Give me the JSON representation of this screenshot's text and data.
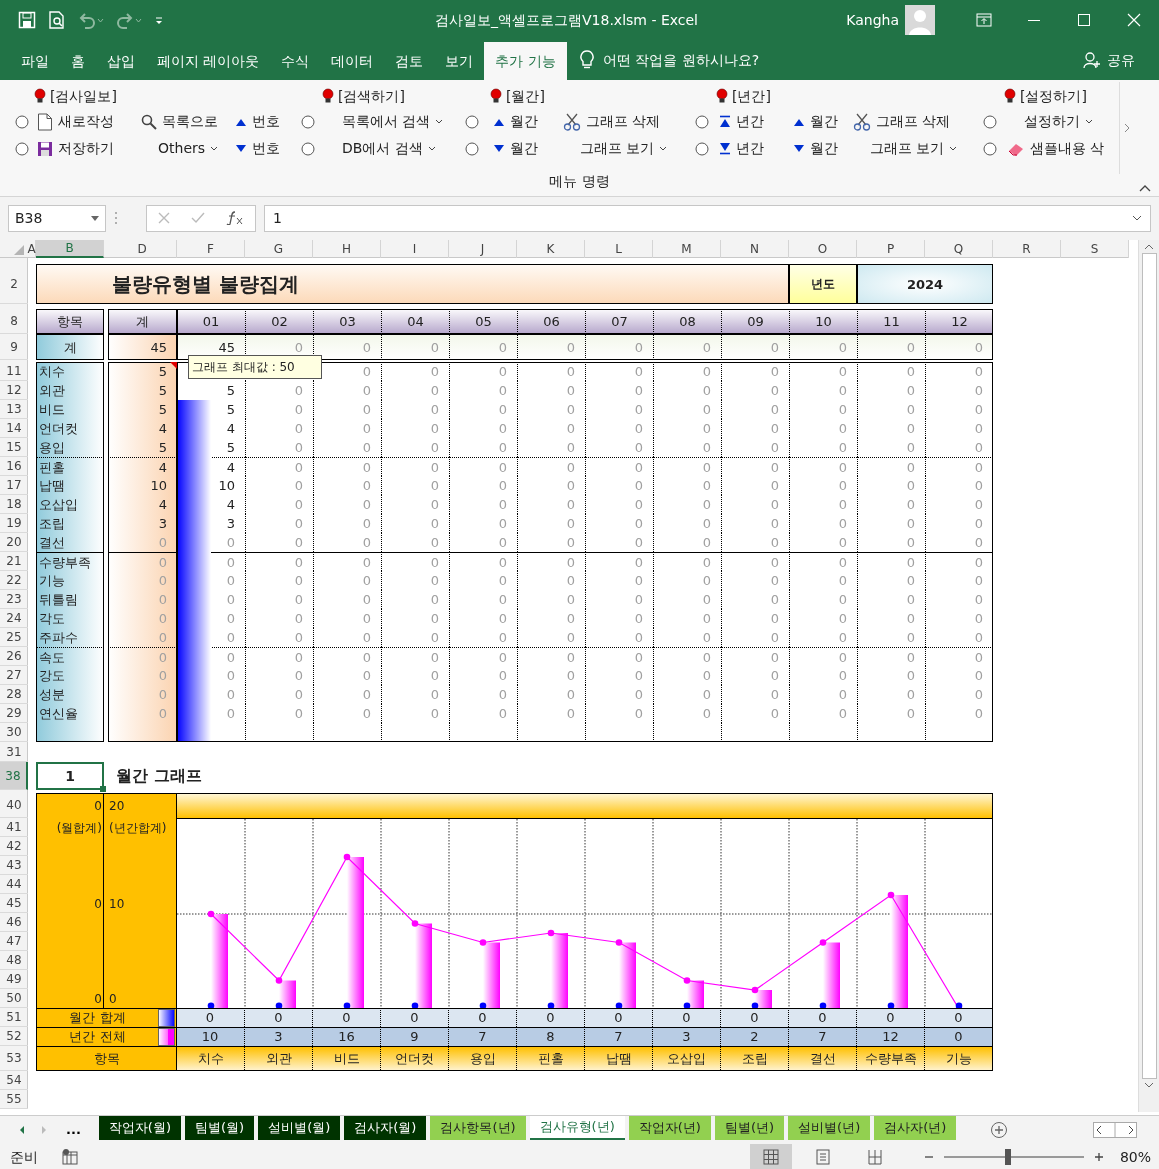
{
  "window": {
    "title": "검사일보_액셀프로그램V18.xlsm  -  Excel",
    "user": "Kangha"
  },
  "quick_access": [
    {
      "kind": "save",
      "disabled": false
    },
    {
      "kind": "print_preview",
      "disabled": false
    },
    {
      "kind": "undo",
      "disabled": true
    },
    {
      "kind": "redo",
      "disabled": true
    },
    {
      "kind": "customize",
      "disabled": false
    }
  ],
  "ribbon_tabs": [
    {
      "label": "파일",
      "selected": false
    },
    {
      "label": "홈",
      "selected": false
    },
    {
      "label": "삽입",
      "selected": false
    },
    {
      "label": "페이지 레이아웃",
      "selected": false
    },
    {
      "label": "수식",
      "selected": false
    },
    {
      "label": "데이터",
      "selected": false
    },
    {
      "label": "검토",
      "selected": false
    },
    {
      "label": "보기",
      "selected": false
    },
    {
      "label": "추가 기능",
      "selected": true
    }
  ],
  "tell_me": "어떤 작업을 원하시나요?",
  "share": "공유",
  "ribbon": {
    "group_label": "메뉴 명령",
    "columns": [
      {
        "items": [
          {
            "kind": "radio",
            "checked": false
          },
          {
            "kind": "radio",
            "checked": false
          }
        ]
      },
      {
        "header": "[검사일보]",
        "items": [
          {
            "kind": "new",
            "label": "새로작성"
          },
          {
            "kind": "save",
            "label": "저장하기"
          }
        ]
      },
      {
        "items": [
          {
            "kind": "search",
            "label": "목록으로"
          },
          {
            "kind": "dropdown",
            "label": "Others"
          }
        ]
      },
      {
        "items": [
          {
            "kind": "up",
            "label": "번호"
          },
          {
            "kind": "down",
            "label": "번호"
          }
        ]
      },
      {
        "items": [
          {
            "kind": "radio",
            "checked": false
          },
          {
            "kind": "radio",
            "checked": false
          }
        ]
      },
      {
        "header": "[검색하기]",
        "items": [
          {
            "kind": "dropdown",
            "label": "목록에서 검색"
          },
          {
            "kind": "dropdown",
            "label": "DB에서 검색"
          }
        ]
      },
      {
        "items": [
          {
            "kind": "radio",
            "checked": false
          },
          {
            "kind": "radio",
            "checked": false
          }
        ]
      },
      {
        "header": "[월간]",
        "items": [
          {
            "kind": "up",
            "label": "월간"
          },
          {
            "kind": "down",
            "label": "월간"
          }
        ]
      },
      {
        "items": [
          {
            "kind": "cut",
            "label": "그래프 삭제"
          },
          {
            "kind": "dropdown",
            "label": "그래프 보기"
          }
        ]
      },
      {
        "items": [
          {
            "kind": "radio",
            "checked": false
          },
          {
            "kind": "radio",
            "checked": false
          }
        ]
      },
      {
        "header": "[년간]",
        "items": [
          {
            "kind": "top",
            "label": "년간"
          },
          {
            "kind": "bottom",
            "label": "년간"
          }
        ]
      },
      {
        "items": [
          {
            "kind": "up",
            "label": "월간"
          },
          {
            "kind": "down",
            "label": "월간"
          }
        ]
      },
      {
        "items": [
          {
            "kind": "cut",
            "label": "그래프 삭제"
          },
          {
            "kind": "dropdown",
            "label": "그래프 보기"
          }
        ]
      },
      {
        "items": [
          {
            "kind": "radio",
            "checked": false
          },
          {
            "kind": "radio",
            "checked": false
          }
        ]
      },
      {
        "header": "[설정하기]",
        "items": [
          {
            "kind": "dropdown",
            "label": "설정하기"
          },
          {
            "kind": "eraser",
            "label": "샘플내용 삭"
          }
        ]
      }
    ]
  },
  "formula_bar": {
    "name_box": "B38",
    "formula": "1"
  },
  "column_headers": [
    {
      "label": "A",
      "selected": false
    },
    {
      "label": "B",
      "selected": true
    },
    {
      "label": "D",
      "selected": false
    },
    {
      "label": "F",
      "selected": false
    },
    {
      "label": "G",
      "selected": false
    },
    {
      "label": "H",
      "selected": false
    },
    {
      "label": "I",
      "selected": false
    },
    {
      "label": "J",
      "selected": false
    },
    {
      "label": "K",
      "selected": false
    },
    {
      "label": "L",
      "selected": false
    },
    {
      "label": "M",
      "selected": false
    },
    {
      "label": "N",
      "selected": false
    },
    {
      "label": "O",
      "selected": false
    },
    {
      "label": "P",
      "selected": false
    },
    {
      "label": "Q",
      "selected": false
    },
    {
      "label": "R",
      "selected": false
    },
    {
      "label": "S",
      "selected": false
    }
  ],
  "row_headers": [
    {
      "label": "2",
      "selected": false
    },
    {
      "label": "8",
      "selected": false
    },
    {
      "label": "9",
      "selected": false
    },
    {
      "label": "11",
      "selected": false
    },
    {
      "label": "12",
      "selected": false
    },
    {
      "label": "13",
      "selected": false
    },
    {
      "label": "14",
      "selected": false
    },
    {
      "label": "15",
      "selected": false
    },
    {
      "label": "16",
      "selected": false
    },
    {
      "label": "17",
      "selected": false
    },
    {
      "label": "18",
      "selected": false
    },
    {
      "label": "19",
      "selected": false
    },
    {
      "label": "20",
      "selected": false
    },
    {
      "label": "21",
      "selected": false
    },
    {
      "label": "22",
      "selected": false
    },
    {
      "label": "23",
      "selected": false
    },
    {
      "label": "24",
      "selected": false
    },
    {
      "label": "25",
      "selected": false
    },
    {
      "label": "26",
      "selected": false
    },
    {
      "label": "27",
      "selected": false
    },
    {
      "label": "28",
      "selected": false
    },
    {
      "label": "29",
      "selected": false
    },
    {
      "label": "30",
      "selected": false
    },
    {
      "label": "31",
      "selected": false
    },
    {
      "label": "38",
      "selected": true
    },
    {
      "label": "40",
      "selected": false
    },
    {
      "label": "41",
      "selected": false
    },
    {
      "label": "42",
      "selected": false
    },
    {
      "label": "43",
      "selected": false
    },
    {
      "label": "44",
      "selected": false
    },
    {
      "label": "45",
      "selected": false
    },
    {
      "label": "46",
      "selected": false
    },
    {
      "label": "47",
      "selected": false
    },
    {
      "label": "48",
      "selected": false
    },
    {
      "label": "49",
      "selected": false
    },
    {
      "label": "50",
      "selected": false
    },
    {
      "label": "51",
      "selected": false
    },
    {
      "label": "52",
      "selected": false
    },
    {
      "label": "53",
      "selected": false
    },
    {
      "label": "54",
      "selected": false
    },
    {
      "label": "55",
      "selected": false
    }
  ],
  "report": {
    "title": "불량유형별 불량집계",
    "year_label": "년도",
    "year": "2024",
    "comment": "그래프 최대값 : 50",
    "header": {
      "item": "항목",
      "total": "계",
      "months": [
        "01",
        "02",
        "03",
        "04",
        "05",
        "06",
        "07",
        "08",
        "09",
        "10",
        "11",
        "12"
      ]
    },
    "total_row": {
      "label": "계",
      "total": "45",
      "months": [
        {
          "text": "45",
          "muted": false
        },
        {
          "text": "0",
          "muted": true
        },
        {
          "text": "0",
          "muted": true
        },
        {
          "text": "0",
          "muted": true
        },
        {
          "text": "0",
          "muted": true
        },
        {
          "text": "0",
          "muted": true
        },
        {
          "text": "0",
          "muted": true
        },
        {
          "text": "0",
          "muted": true
        },
        {
          "text": "0",
          "muted": true
        },
        {
          "text": "0",
          "muted": true
        },
        {
          "text": "0",
          "muted": true
        },
        {
          "text": "0",
          "muted": true
        }
      ]
    },
    "groups": [
      [
        {
          "label": "치수",
          "covered_by_note": true,
          "total": {
            "text": "5",
            "muted": false
          },
          "months": [
            {
              "text": "0",
              "muted": true
            },
            {
              "text": "0",
              "muted": true
            },
            {
              "text": "0",
              "muted": true
            },
            {
              "text": "0",
              "muted": true
            },
            {
              "text": "0",
              "muted": true
            },
            {
              "text": "0",
              "muted": true
            },
            {
              "text": "0",
              "muted": true
            },
            {
              "text": "0",
              "muted": true
            },
            {
              "text": "0",
              "muted": true
            },
            {
              "text": "0",
              "muted": true
            }
          ]
        },
        {
          "label": "외관",
          "total": {
            "text": "5",
            "muted": false
          },
          "months": [
            {
              "text": "5",
              "muted": false
            },
            {
              "text": "0",
              "muted": true
            },
            {
              "text": "0",
              "muted": true
            },
            {
              "text": "0",
              "muted": true
            },
            {
              "text": "0",
              "muted": true
            },
            {
              "text": "0",
              "muted": true
            },
            {
              "text": "0",
              "muted": true
            },
            {
              "text": "0",
              "muted": true
            },
            {
              "text": "0",
              "muted": true
            },
            {
              "text": "0",
              "muted": true
            },
            {
              "text": "0",
              "muted": true
            },
            {
              "text": "0",
              "muted": true
            }
          ]
        },
        {
          "label": "비드",
          "total": {
            "text": "5",
            "muted": false
          },
          "months": [
            {
              "text": "5",
              "muted": false
            },
            {
              "text": "0",
              "muted": true
            },
            {
              "text": "0",
              "muted": true
            },
            {
              "text": "0",
              "muted": true
            },
            {
              "text": "0",
              "muted": true
            },
            {
              "text": "0",
              "muted": true
            },
            {
              "text": "0",
              "muted": true
            },
            {
              "text": "0",
              "muted": true
            },
            {
              "text": "0",
              "muted": true
            },
            {
              "text": "0",
              "muted": true
            },
            {
              "text": "0",
              "muted": true
            },
            {
              "text": "0",
              "muted": true
            }
          ]
        },
        {
          "label": "언더컷",
          "total": {
            "text": "4",
            "muted": false
          },
          "months": [
            {
              "text": "4",
              "muted": false
            },
            {
              "text": "0",
              "muted": true
            },
            {
              "text": "0",
              "muted": true
            },
            {
              "text": "0",
              "muted": true
            },
            {
              "text": "0",
              "muted": true
            },
            {
              "text": "0",
              "muted": true
            },
            {
              "text": "0",
              "muted": true
            },
            {
              "text": "0",
              "muted": true
            },
            {
              "text": "0",
              "muted": true
            },
            {
              "text": "0",
              "muted": true
            },
            {
              "text": "0",
              "muted": true
            },
            {
              "text": "0",
              "muted": true
            }
          ]
        },
        {
          "label": "용입",
          "total": {
            "text": "5",
            "muted": false
          },
          "months": [
            {
              "text": "5",
              "muted": false
            },
            {
              "text": "0",
              "muted": true
            },
            {
              "text": "0",
              "muted": true
            },
            {
              "text": "0",
              "muted": true
            },
            {
              "text": "0",
              "muted": true
            },
            {
              "text": "0",
              "muted": true
            },
            {
              "text": "0",
              "muted": true
            },
            {
              "text": "0",
              "muted": true
            },
            {
              "text": "0",
              "muted": true
            },
            {
              "text": "0",
              "muted": true
            },
            {
              "text": "0",
              "muted": true
            },
            {
              "text": "0",
              "muted": true
            }
          ]
        }
      ],
      [
        {
          "label": "핀홀",
          "total": {
            "text": "4",
            "muted": false
          },
          "months": [
            {
              "text": "4",
              "muted": false
            },
            {
              "text": "0",
              "muted": true
            },
            {
              "text": "0",
              "muted": true
            },
            {
              "text": "0",
              "muted": true
            },
            {
              "text": "0",
              "muted": true
            },
            {
              "text": "0",
              "muted": true
            },
            {
              "text": "0",
              "muted": true
            },
            {
              "text": "0",
              "muted": true
            },
            {
              "text": "0",
              "muted": true
            },
            {
              "text": "0",
              "muted": true
            },
            {
              "text": "0",
              "muted": true
            },
            {
              "text": "0",
              "muted": true
            }
          ]
        },
        {
          "label": "납땜",
          "total": {
            "text": "10",
            "muted": false
          },
          "months": [
            {
              "text": "10",
              "muted": false
            },
            {
              "text": "0",
              "muted": true
            },
            {
              "text": "0",
              "muted": true
            },
            {
              "text": "0",
              "muted": true
            },
            {
              "text": "0",
              "muted": true
            },
            {
              "text": "0",
              "muted": true
            },
            {
              "text": "0",
              "muted": true
            },
            {
              "text": "0",
              "muted": true
            },
            {
              "text": "0",
              "muted": true
            },
            {
              "text": "0",
              "muted": true
            },
            {
              "text": "0",
              "muted": true
            },
            {
              "text": "0",
              "muted": true
            }
          ]
        },
        {
          "label": "오삽입",
          "total": {
            "text": "4",
            "muted": false
          },
          "months": [
            {
              "text": "4",
              "muted": false
            },
            {
              "text": "0",
              "muted": true
            },
            {
              "text": "0",
              "muted": true
            },
            {
              "text": "0",
              "muted": true
            },
            {
              "text": "0",
              "muted": true
            },
            {
              "text": "0",
              "muted": true
            },
            {
              "text": "0",
              "muted": true
            },
            {
              "text": "0",
              "muted": true
            },
            {
              "text": "0",
              "muted": true
            },
            {
              "text": "0",
              "muted": true
            },
            {
              "text": "0",
              "muted": true
            },
            {
              "text": "0",
              "muted": true
            }
          ]
        },
        {
          "label": "조립",
          "total": {
            "text": "3",
            "muted": false
          },
          "months": [
            {
              "text": "3",
              "muted": false
            },
            {
              "text": "0",
              "muted": true
            },
            {
              "text": "0",
              "muted": true
            },
            {
              "text": "0",
              "muted": true
            },
            {
              "text": "0",
              "muted": true
            },
            {
              "text": "0",
              "muted": true
            },
            {
              "text": "0",
              "muted": true
            },
            {
              "text": "0",
              "muted": true
            },
            {
              "text": "0",
              "muted": true
            },
            {
              "text": "0",
              "muted": true
            },
            {
              "text": "0",
              "muted": true
            },
            {
              "text": "0",
              "muted": true
            }
          ]
        },
        {
          "label": "결선",
          "total": {
            "text": "0",
            "muted": true
          },
          "months": [
            {
              "text": "0",
              "muted": true
            },
            {
              "text": "0",
              "muted": true
            },
            {
              "text": "0",
              "muted": true
            },
            {
              "text": "0",
              "muted": true
            },
            {
              "text": "0",
              "muted": true
            },
            {
              "text": "0",
              "muted": true
            },
            {
              "text": "0",
              "muted": true
            },
            {
              "text": "0",
              "muted": true
            },
            {
              "text": "0",
              "muted": true
            },
            {
              "text": "0",
              "muted": true
            },
            {
              "text": "0",
              "muted": true
            },
            {
              "text": "0",
              "muted": true
            }
          ]
        }
      ],
      [
        {
          "label": "수량부족",
          "total": {
            "text": "0",
            "muted": true
          },
          "months": [
            {
              "text": "0",
              "muted": true
            },
            {
              "text": "0",
              "muted": true
            },
            {
              "text": "0",
              "muted": true
            },
            {
              "text": "0",
              "muted": true
            },
            {
              "text": "0",
              "muted": true
            },
            {
              "text": "0",
              "muted": true
            },
            {
              "text": "0",
              "muted": true
            },
            {
              "text": "0",
              "muted": true
            },
            {
              "text": "0",
              "muted": true
            },
            {
              "text": "0",
              "muted": true
            },
            {
              "text": "0",
              "muted": true
            },
            {
              "text": "0",
              "muted": true
            }
          ]
        },
        {
          "label": "기능",
          "total": {
            "text": "0",
            "muted": true
          },
          "months": [
            {
              "text": "0",
              "muted": true
            },
            {
              "text": "0",
              "muted": true
            },
            {
              "text": "0",
              "muted": true
            },
            {
              "text": "0",
              "muted": true
            },
            {
              "text": "0",
              "muted": true
            },
            {
              "text": "0",
              "muted": true
            },
            {
              "text": "0",
              "muted": true
            },
            {
              "text": "0",
              "muted": true
            },
            {
              "text": "0",
              "muted": true
            },
            {
              "text": "0",
              "muted": true
            },
            {
              "text": "0",
              "muted": true
            },
            {
              "text": "0",
              "muted": true
            }
          ]
        },
        {
          "label": "뒤틀림",
          "total": {
            "text": "0",
            "muted": true
          },
          "months": [
            {
              "text": "0",
              "muted": true
            },
            {
              "text": "0",
              "muted": true
            },
            {
              "text": "0",
              "muted": true
            },
            {
              "text": "0",
              "muted": true
            },
            {
              "text": "0",
              "muted": true
            },
            {
              "text": "0",
              "muted": true
            },
            {
              "text": "0",
              "muted": true
            },
            {
              "text": "0",
              "muted": true
            },
            {
              "text": "0",
              "muted": true
            },
            {
              "text": "0",
              "muted": true
            },
            {
              "text": "0",
              "muted": true
            },
            {
              "text": "0",
              "muted": true
            }
          ]
        },
        {
          "label": "각도",
          "total": {
            "text": "0",
            "muted": true
          },
          "months": [
            {
              "text": "0",
              "muted": true
            },
            {
              "text": "0",
              "muted": true
            },
            {
              "text": "0",
              "muted": true
            },
            {
              "text": "0",
              "muted": true
            },
            {
              "text": "0",
              "muted": true
            },
            {
              "text": "0",
              "muted": true
            },
            {
              "text": "0",
              "muted": true
            },
            {
              "text": "0",
              "muted": true
            },
            {
              "text": "0",
              "muted": true
            },
            {
              "text": "0",
              "muted": true
            },
            {
              "text": "0",
              "muted": true
            },
            {
              "text": "0",
              "muted": true
            }
          ]
        },
        {
          "label": "주파수",
          "total": {
            "text": "0",
            "muted": true
          },
          "months": [
            {
              "text": "0",
              "muted": true
            },
            {
              "text": "0",
              "muted": true
            },
            {
              "text": "0",
              "muted": true
            },
            {
              "text": "0",
              "muted": true
            },
            {
              "text": "0",
              "muted": true
            },
            {
              "text": "0",
              "muted": true
            },
            {
              "text": "0",
              "muted": true
            },
            {
              "text": "0",
              "muted": true
            },
            {
              "text": "0",
              "muted": true
            },
            {
              "text": "0",
              "muted": true
            },
            {
              "text": "0",
              "muted": true
            },
            {
              "text": "0",
              "muted": true
            }
          ]
        }
      ],
      [
        {
          "label": "속도",
          "total": {
            "text": "0",
            "muted": true
          },
          "months": [
            {
              "text": "0",
              "muted": true
            },
            {
              "text": "0",
              "muted": true
            },
            {
              "text": "0",
              "muted": true
            },
            {
              "text": "0",
              "muted": true
            },
            {
              "text": "0",
              "muted": true
            },
            {
              "text": "0",
              "muted": true
            },
            {
              "text": "0",
              "muted": true
            },
            {
              "text": "0",
              "muted": true
            },
            {
              "text": "0",
              "muted": true
            },
            {
              "text": "0",
              "muted": true
            },
            {
              "text": "0",
              "muted": true
            },
            {
              "text": "0",
              "muted": true
            }
          ]
        },
        {
          "label": "강도",
          "total": {
            "text": "0",
            "muted": true
          },
          "months": [
            {
              "text": "0",
              "muted": true
            },
            {
              "text": "0",
              "muted": true
            },
            {
              "text": "0",
              "muted": true
            },
            {
              "text": "0",
              "muted": true
            },
            {
              "text": "0",
              "muted": true
            },
            {
              "text": "0",
              "muted": true
            },
            {
              "text": "0",
              "muted": true
            },
            {
              "text": "0",
              "muted": true
            },
            {
              "text": "0",
              "muted": true
            },
            {
              "text": "0",
              "muted": true
            },
            {
              "text": "0",
              "muted": true
            },
            {
              "text": "0",
              "muted": true
            }
          ]
        },
        {
          "label": "성분",
          "total": {
            "text": "0",
            "muted": true
          },
          "months": [
            {
              "text": "0",
              "muted": true
            },
            {
              "text": "0",
              "muted": true
            },
            {
              "text": "0",
              "muted": true
            },
            {
              "text": "0",
              "muted": true
            },
            {
              "text": "0",
              "muted": true
            },
            {
              "text": "0",
              "muted": true
            },
            {
              "text": "0",
              "muted": true
            },
            {
              "text": "0",
              "muted": true
            },
            {
              "text": "0",
              "muted": true
            },
            {
              "text": "0",
              "muted": true
            },
            {
              "text": "0",
              "muted": true
            },
            {
              "text": "0",
              "muted": true
            }
          ]
        },
        {
          "label": "연신율",
          "total": {
            "text": "0",
            "muted": true
          },
          "months": [
            {
              "text": "0",
              "muted": true
            },
            {
              "text": "0",
              "muted": true
            },
            {
              "text": "0",
              "muted": true
            },
            {
              "text": "0",
              "muted": true
            },
            {
              "text": "0",
              "muted": true
            },
            {
              "text": "0",
              "muted": true
            },
            {
              "text": "0",
              "muted": true
            },
            {
              "text": "0",
              "muted": true
            },
            {
              "text": "0",
              "muted": true
            },
            {
              "text": "0",
              "muted": true
            },
            {
              "text": "0",
              "muted": true
            },
            {
              "text": "0",
              "muted": true
            }
          ]
        }
      ]
    ]
  },
  "graph": {
    "selector": "1",
    "title": "월간 그래프",
    "left_axis": [
      "0",
      "(월합계)",
      "0",
      "0"
    ],
    "monthly_total": {
      "label": "월간 합계",
      "values": [
        "0",
        "0",
        "0",
        "0",
        "0",
        "0",
        "0",
        "0",
        "0",
        "0",
        "0",
        "0"
      ]
    },
    "right_axis": [
      "20",
      "(년간합계)",
      "10",
      "0"
    ],
    "category_label": "항목",
    "chart_data": {
      "type": "bar",
      "categories": [
        "치수",
        "외관",
        "비드",
        "언더컷",
        "용입",
        "핀홀",
        "납땜",
        "오삽입",
        "조립",
        "결선",
        "수량부족",
        "기능"
      ],
      "data_labels": true,
      "series": [
        {
          "name": "년간 전체",
          "color": "#ff00ff",
          "values": [
            10,
            3,
            16,
            9,
            7,
            8,
            7,
            3,
            2,
            7,
            12,
            0
          ]
        }
      ]
    }
  },
  "sheet_nav_more": "...",
  "sheet_tabs": [
    {
      "label": "작업자(월)",
      "kind": "monthly",
      "selected": false
    },
    {
      "label": "팀별(월)",
      "kind": "monthly",
      "selected": false
    },
    {
      "label": "설비별(월)",
      "kind": "monthly",
      "selected": false
    },
    {
      "label": "검사자(월)",
      "kind": "monthly",
      "selected": false
    },
    {
      "label": "검사항목(년)",
      "kind": "yearly",
      "selected": false
    },
    {
      "label": "검사유형(년)",
      "kind": "yearly",
      "selected": true
    },
    {
      "label": "작업자(년)",
      "kind": "yearly",
      "selected": false
    },
    {
      "label": "팀별(년)",
      "kind": "yearly",
      "selected": false
    },
    {
      "label": "설비별(년)",
      "kind": "yearly",
      "selected": false
    },
    {
      "label": "검사자(년)",
      "kind": "yearly",
      "selected": false
    }
  ],
  "status_bar": {
    "text": "준비",
    "views": [
      {
        "kind": "normal",
        "selected": true
      },
      {
        "kind": "page_layout",
        "selected": false
      },
      {
        "kind": "page_break",
        "selected": false
      }
    ],
    "zoom_slider": {
      "level": 0.46
    },
    "zoom": "80%"
  }
}
